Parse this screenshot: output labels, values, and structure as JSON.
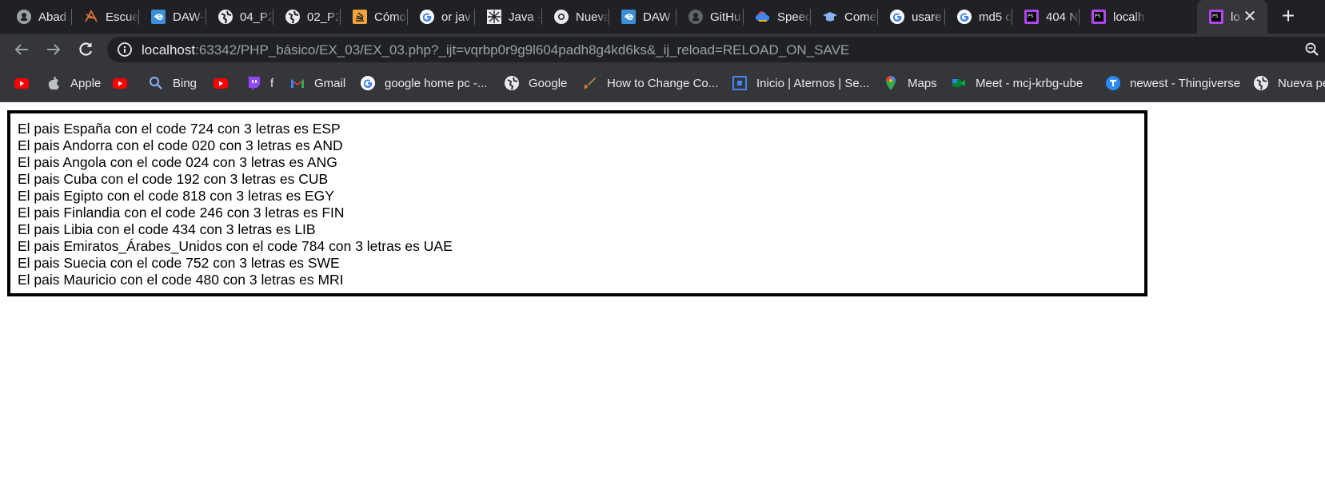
{
  "browser": {
    "tabs": [
      {
        "title": "Abad",
        "icon": "github-icon"
      },
      {
        "title": "Escue",
        "icon": "school-logo-icon"
      },
      {
        "title": "DAW-",
        "icon": "edge-icon"
      },
      {
        "title": "04_P2",
        "icon": "globe-icon"
      },
      {
        "title": "02_P2",
        "icon": "globe-icon"
      },
      {
        "title": "Cómo",
        "icon": "stackoverflow-icon"
      },
      {
        "title": "or jav",
        "icon": "google-icon"
      },
      {
        "title": "Java -",
        "icon": "java-site-icon"
      },
      {
        "title": "Nueva",
        "icon": "chrome-icon"
      },
      {
        "title": "DAW",
        "icon": "edge-icon"
      },
      {
        "title": "GitHu",
        "icon": "github-icon"
      },
      {
        "title": "Speed",
        "icon": "cloud-icon"
      },
      {
        "title": "Come",
        "icon": "graduation-cap-icon"
      },
      {
        "title": "usare",
        "icon": "google-icon"
      },
      {
        "title": "md5 c",
        "icon": "google-icon"
      },
      {
        "title": "404 N",
        "icon": "phpstorm-icon"
      },
      {
        "title": "localh",
        "icon": "phpstorm-icon"
      },
      {
        "title": "lo",
        "icon": "phpstorm-icon",
        "active": true
      }
    ],
    "new_tab_label": "+",
    "close_tab_label": "✕",
    "address": {
      "host": "localhost",
      "path": ":63342/PHP_básico/EX_03/EX_03.php?_ijt=vqrbp0r9g9l604padh8g4kd6ks&_ij_reload=RELOAD_ON_SAVE"
    },
    "bookmarks": [
      {
        "label": "",
        "icon": "youtube-icon"
      },
      {
        "label": "Apple",
        "icon": "apple-icon"
      },
      {
        "label": "",
        "icon": "youtube-icon"
      },
      {
        "label": "Bing",
        "icon": "search-icon"
      },
      {
        "label": "",
        "icon": "youtube-icon"
      },
      {
        "label": "f",
        "icon": "twitch-icon"
      },
      {
        "label": "Gmail",
        "icon": "gmail-icon"
      },
      {
        "label": "google home pc -...",
        "icon": "google-icon"
      },
      {
        "label": "Google",
        "icon": "globe-icon"
      },
      {
        "label": "How to Change Co...",
        "icon": "brush-icon"
      },
      {
        "label": "Inicio | Aternos | Se...",
        "icon": "aternos-icon"
      },
      {
        "label": "Maps",
        "icon": "maps-pin-icon"
      },
      {
        "label": "Meet - mcj-krbg-ube",
        "icon": "meet-icon"
      },
      {
        "label": "newest - Thingiverse",
        "icon": "thingiverse-icon"
      },
      {
        "label": "Nueva pe",
        "icon": "globe-icon"
      }
    ],
    "colors": {
      "tabstrip": "#202124",
      "toolbar": "#35363a",
      "text": "#e8eaed",
      "url_muted": "#9aa0a6"
    }
  },
  "page": {
    "lines": [
      "El pais España con el code 724 con 3 letras es ESP",
      "El pais Andorra con el code 020 con 3 letras es AND",
      "El pais Angola con el code 024 con 3 letras es ANG",
      "El pais Cuba con el code 192 con 3 letras es CUB",
      "El pais Egipto con el code 818 con 3 letras es EGY",
      "El pais Finlandia con el code 246 con 3 letras es FIN",
      "El pais Libia con el code 434 con 3 letras es LIB",
      "El pais Emiratos_Árabes_Unidos con el code 784 con 3 letras es UAE",
      "El pais Suecia con el code 752 con 3 letras es SWE",
      "El pais Mauricio con el code 480 con 3 letras es MRI"
    ]
  }
}
